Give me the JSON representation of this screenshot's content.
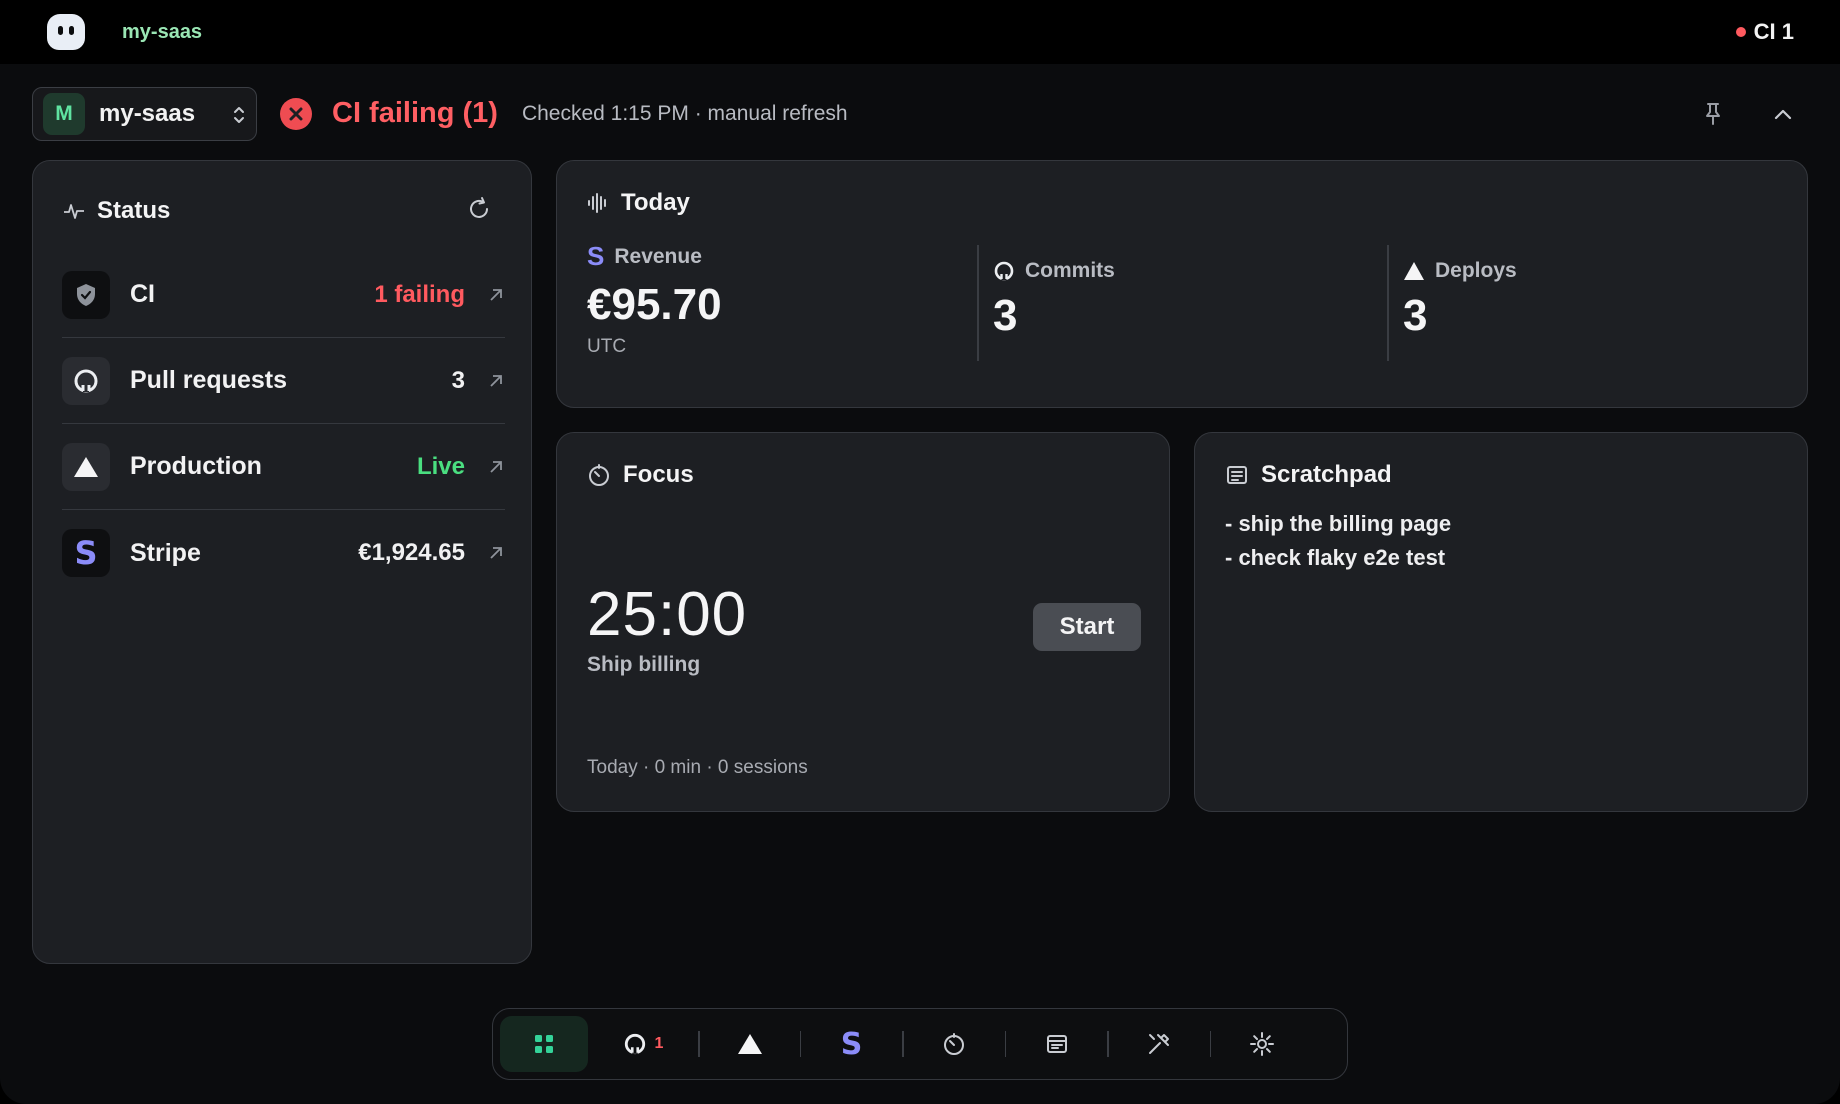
{
  "app": {
    "name": "my-saas",
    "tray_label": "CI 1"
  },
  "header": {
    "project_initial": "M",
    "project_name": "my-saas",
    "status_headline": "CI failing (1)",
    "checked_text": "Checked 1:15 PM · manual refresh"
  },
  "status_card": {
    "title": "Status",
    "rows": [
      {
        "label": "CI",
        "value": "1 failing",
        "icon": "shield-check-icon"
      },
      {
        "label": "Pull requests",
        "value": "3",
        "icon": "github-icon"
      },
      {
        "label": "Production",
        "value": "Live",
        "icon": "triangle-icon"
      },
      {
        "label": "Stripe",
        "value": "€1,924.65",
        "icon": "stripe-icon"
      }
    ]
  },
  "today_card": {
    "title": "Today",
    "revenue": {
      "label": "Revenue",
      "value": "€95.70",
      "sub": "UTC"
    },
    "commits": {
      "label": "Commits",
      "value": "3"
    },
    "deploys": {
      "label": "Deploys",
      "value": "3"
    }
  },
  "focus_card": {
    "title": "Focus",
    "timer": "25:00",
    "task": "Ship billing",
    "start_label": "Start",
    "stats": "Today · 0 min · 0 sessions"
  },
  "scratchpad": {
    "title": "Scratchpad",
    "lines": [
      "- ship the billing page",
      "- check flaky e2e test"
    ]
  },
  "dock": {
    "items": [
      "overview-icon",
      "github-icon",
      "triangle-icon",
      "stripe-icon",
      "timer-icon",
      "notes-icon",
      "tools-icon",
      "settings-icon"
    ],
    "github_badge": "1"
  },
  "colors": {
    "danger": "#ff5a5f",
    "success": "#4ade80",
    "accent": "#9ae6b4",
    "stripe": "#8b8cf8"
  }
}
